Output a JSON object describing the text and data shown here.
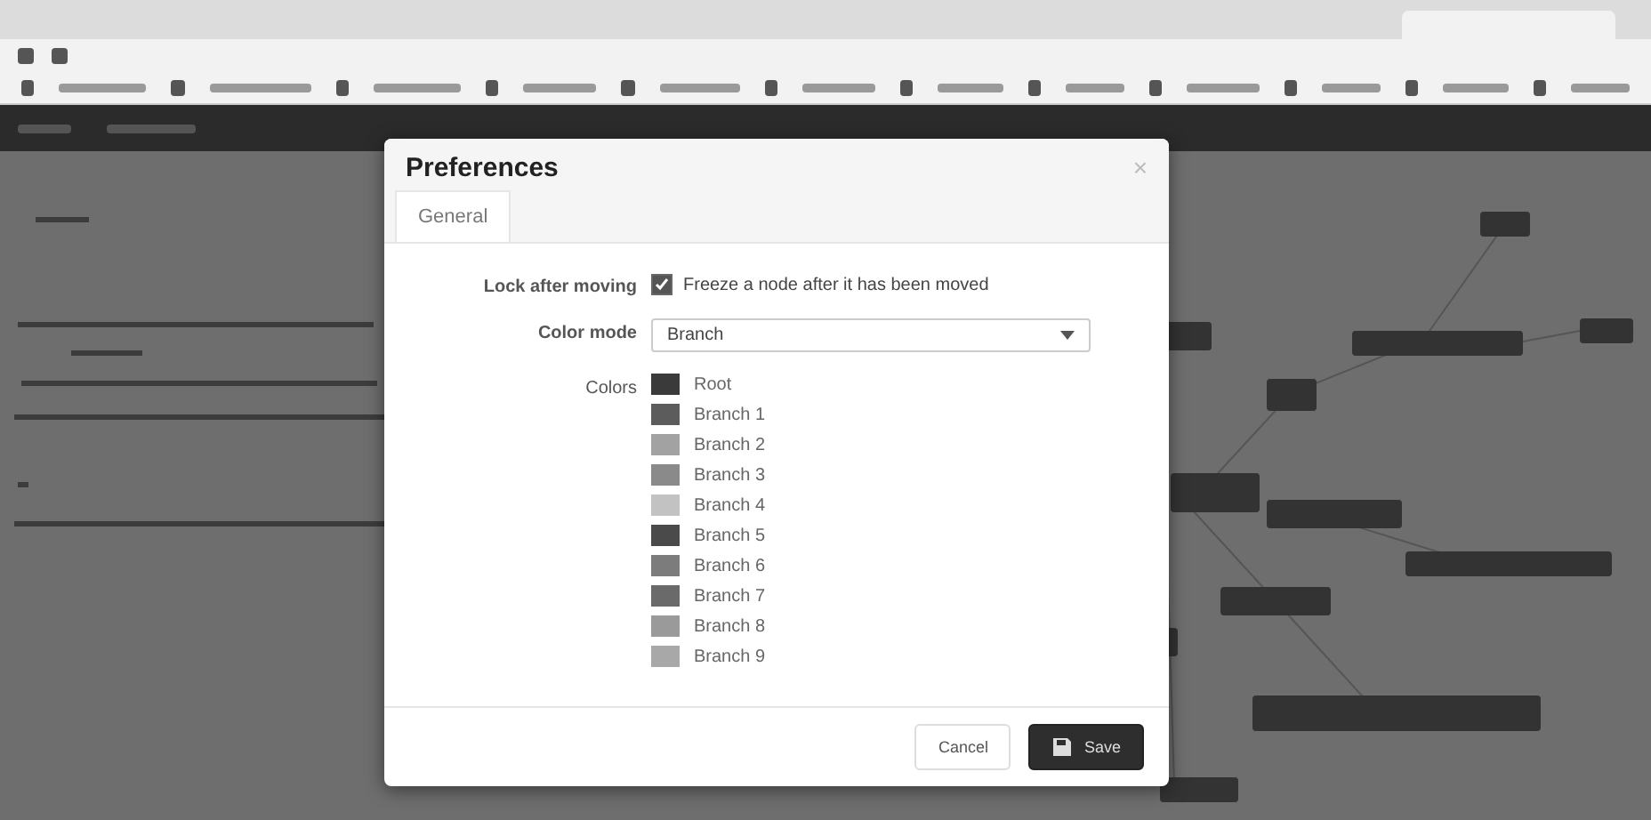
{
  "dialog": {
    "title": "Preferences",
    "close": "×",
    "tabs": [
      {
        "label": "General",
        "selected": true
      }
    ],
    "lock_after_moving": {
      "label": "Lock after moving",
      "checked": true,
      "text": "Freeze a node after it has been moved"
    },
    "color_mode": {
      "label": "Color mode",
      "value": "Branch"
    },
    "colors": {
      "label": "Colors",
      "items": [
        {
          "name": "Root",
          "color": "#3a3a3a"
        },
        {
          "name": "Branch 1",
          "color": "#5c5c5c"
        },
        {
          "name": "Branch 2",
          "color": "#a2a2a2"
        },
        {
          "name": "Branch 3",
          "color": "#8a8a8a"
        },
        {
          "name": "Branch 4",
          "color": "#c2c2c2"
        },
        {
          "name": "Branch 5",
          "color": "#4a4a4a"
        },
        {
          "name": "Branch 6",
          "color": "#7c7c7c"
        },
        {
          "name": "Branch 7",
          "color": "#6a6a6a"
        },
        {
          "name": "Branch 8",
          "color": "#9a9a9a"
        },
        {
          "name": "Branch 9",
          "color": "#a8a8a8"
        }
      ]
    },
    "buttons": [
      {
        "kind": "cancel",
        "label": "Cancel"
      },
      {
        "kind": "save",
        "label": "Save"
      }
    ]
  }
}
